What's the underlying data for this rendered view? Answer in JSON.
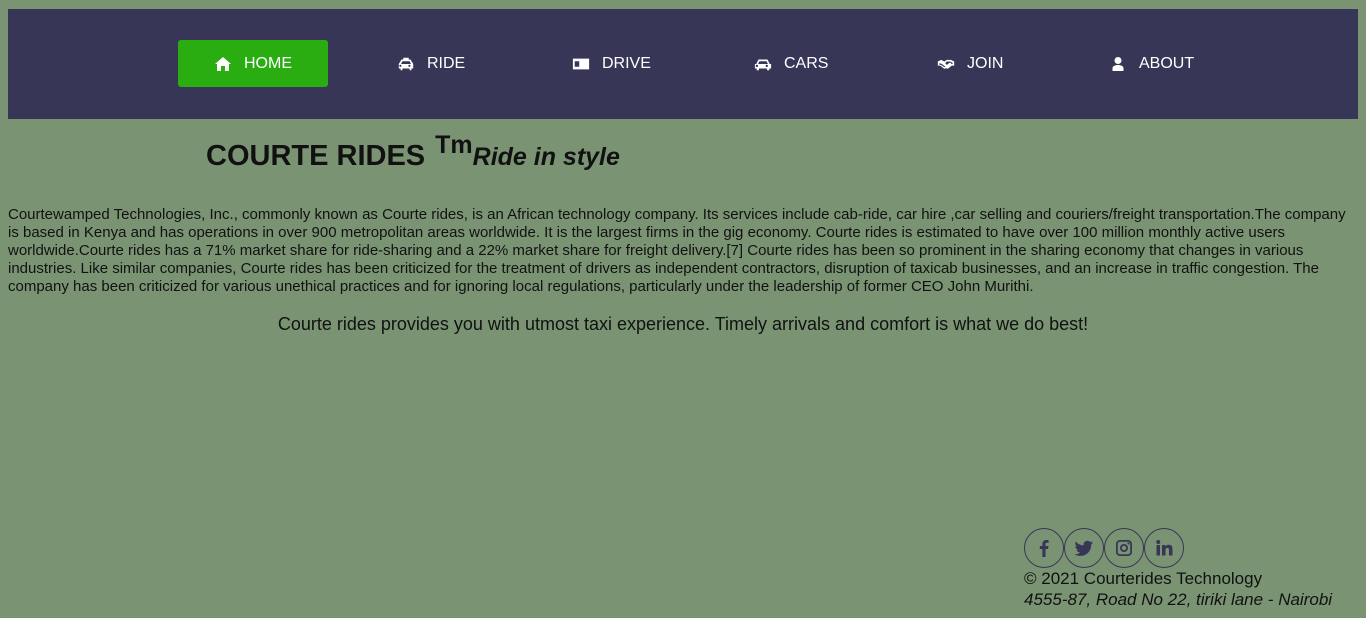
{
  "nav": {
    "items": [
      {
        "label": "HOME",
        "icon": "home-icon",
        "active": true
      },
      {
        "label": "RIDE",
        "icon": "taxi-icon",
        "active": false
      },
      {
        "label": "DRIVE",
        "icon": "id-card-icon",
        "active": false
      },
      {
        "label": "CARS",
        "icon": "car-icon",
        "active": false
      },
      {
        "label": "JOIN",
        "icon": "handshake-icon",
        "active": false
      },
      {
        "label": "ABOUT",
        "icon": "user-icon",
        "active": false
      }
    ]
  },
  "header": {
    "title": "COURTE RIDES",
    "tm": "Tm",
    "tagline": "Ride in style"
  },
  "main": {
    "about": "Courtewamped Technologies, Inc., commonly known as Courte rides, is an African technology company. Its services include cab-ride, car hire ,car selling and couriers/freight transportation.The company is based in Kenya and has operations in over 900 metropolitan areas worldwide. It is the largest firms in the gig economy. Courte rides is estimated to have over 100 million monthly active users worldwide.Courte rides has a 71% market share for ride-sharing and a 22% market share for freight delivery.[7] Courte rides has been so prominent in the sharing economy that changes in various industries. Like similar companies, Courte rides has been criticized for the treatment of drivers as independent contractors, disruption of taxicab businesses, and an increase in traffic congestion. The company has been criticized for various unethical practices and for ignoring local regulations, particularly under the leadership of former CEO John Murithi.",
    "promise": "Courte rides provides you with utmost taxi experience. Timely arrivals and comfort is what we do best!"
  },
  "footer": {
    "socials": [
      "facebook-icon",
      "twitter-icon",
      "instagram-icon",
      "linkedin-icon"
    ],
    "copyright": "© 2021 Courterides Technology",
    "address": "4555-87, Road No 22, tiriki lane - Nairobi"
  },
  "colors": {
    "background": "#7a9473",
    "navbar": "#373656",
    "active": "#2aad11"
  }
}
